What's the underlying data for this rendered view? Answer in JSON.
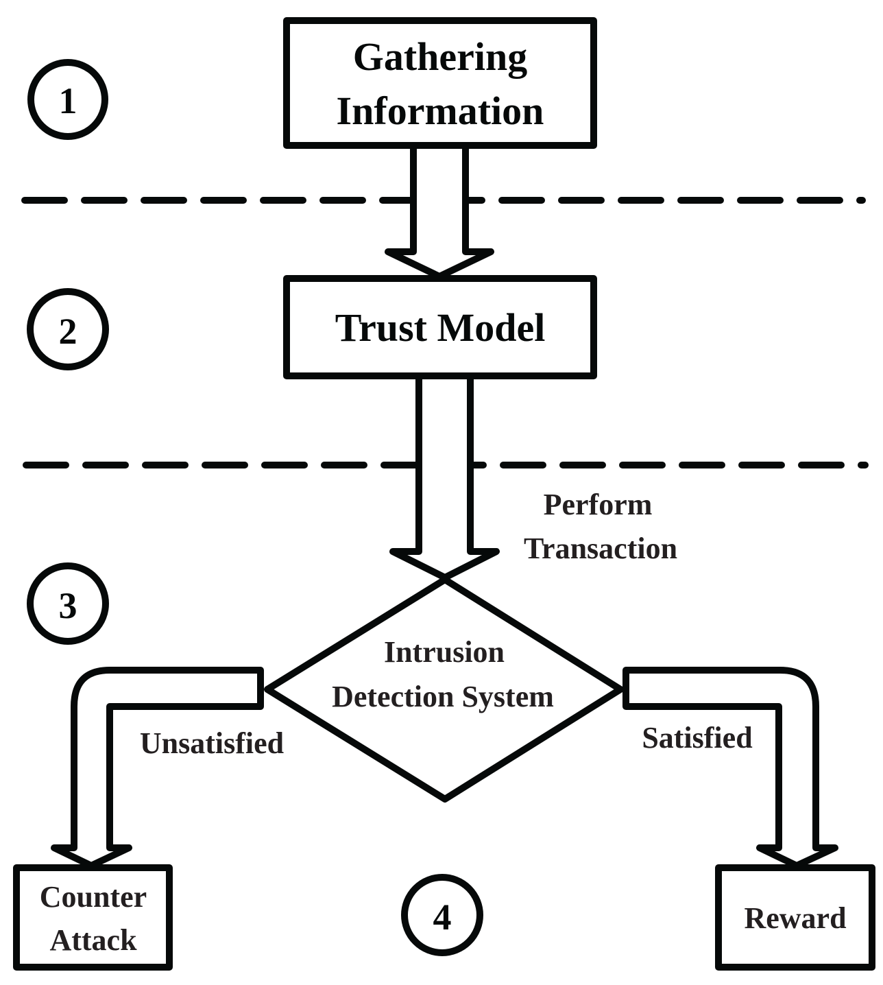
{
  "diagram": {
    "stages": [
      {
        "number": "1"
      },
      {
        "number": "2"
      },
      {
        "number": "3"
      },
      {
        "number": "4"
      }
    ],
    "nodes": {
      "gathering": {
        "lines": [
          "Gathering",
          "Information"
        ]
      },
      "trust_model": {
        "label": "Trust Model"
      },
      "ids": {
        "lines": [
          "Intrusion",
          "Detection System"
        ]
      },
      "counter_attack": {
        "lines": [
          "Counter",
          "Attack"
        ]
      },
      "reward": {
        "label": "Reward"
      }
    },
    "edge_labels": {
      "perform_transaction": [
        "Perform",
        "Transaction"
      ],
      "unsatisfied": "Unsatisfied",
      "satisfied": "Satisfied"
    },
    "colors": {
      "stroke": "#060909",
      "text": "#231f20",
      "background": "#ffffff"
    }
  }
}
